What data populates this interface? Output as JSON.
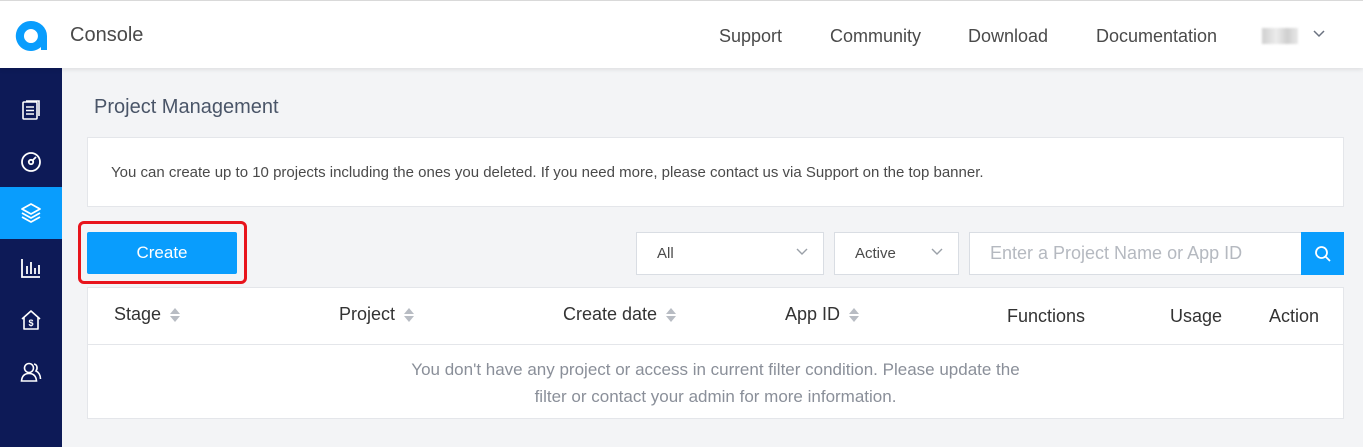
{
  "header": {
    "brand": "Console",
    "nav": [
      "Support",
      "Community",
      "Download",
      "Documentation"
    ]
  },
  "sidebar": {
    "items": [
      {
        "icon": "document-list-icon"
      },
      {
        "icon": "dashboard-gauge-icon"
      },
      {
        "icon": "layers-icon",
        "active": true
      },
      {
        "icon": "bar-chart-icon"
      },
      {
        "icon": "house-dollar-icon"
      },
      {
        "icon": "users-icon"
      }
    ]
  },
  "main": {
    "title": "Project Management",
    "notice": "You can create up to 10 projects including the ones you deleted. If you need more, please contact us via Support on the top banner.",
    "create_label": "Create",
    "filters": {
      "stage_value": "All",
      "status_value": "Active",
      "search_placeholder": "Enter a Project Name or App ID"
    },
    "table": {
      "columns": [
        "Stage",
        "Project",
        "Create date",
        "App ID",
        "Functions",
        "Usage",
        "Action"
      ],
      "empty_line1": "You don't have any project or access in current filter condition. Please update the",
      "empty_line2": "filter or contact your admin for more information."
    }
  },
  "colors": {
    "accent": "#099dfd",
    "sidebar": "#0d1a57",
    "highlight": "#e8141c"
  }
}
